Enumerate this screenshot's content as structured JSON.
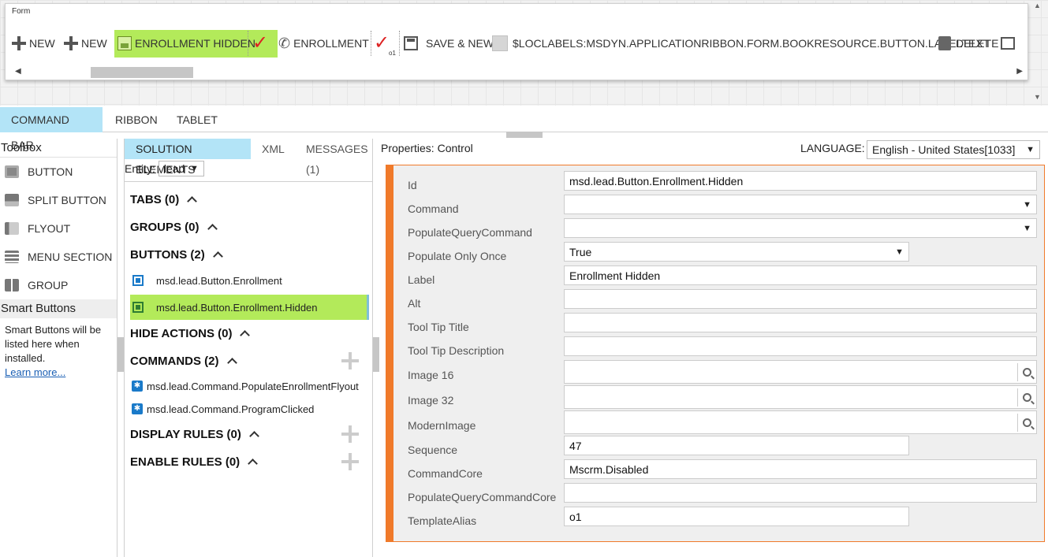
{
  "preview": {
    "form_label": "Form",
    "ribbon": {
      "new1": "NEW",
      "new2": "NEW",
      "enrollment_hidden": "ENROLLMENT HIDDEN",
      "enrollment": "ENROLLMENT",
      "o1": "o1",
      "save_new": "SAVE & NEW",
      "book_resource": "$LOCLABELS:MSDYN.APPLICATIONRIBBON.FORM.BOOKRESOURCE.BUTTON.LABELTEXT",
      "delete": "DELETE"
    }
  },
  "tabs": [
    "COMMAND BAR",
    "RIBBON",
    "TABLET"
  ],
  "toolbox": {
    "title": "Toolbox",
    "items": [
      "BUTTON",
      "SPLIT BUTTON",
      "FLYOUT",
      "MENU SECTION",
      "GROUP"
    ],
    "smart_title": "Smart Buttons",
    "smart_text": "Smart Buttons will be listed here when installed.",
    "learn_more": "Learn more..."
  },
  "solution": {
    "tabs": [
      "SOLUTION ELEMENTS",
      "XML",
      "MESSAGES (1)"
    ],
    "entity_label": "Entity:",
    "entity_value": "lead",
    "sections": {
      "tabs": "TABS (0)",
      "groups": "GROUPS (0)",
      "buttons": "BUTTONS (2)",
      "hide_actions": "HIDE ACTIONS (0)",
      "commands": "COMMANDS (2)",
      "display_rules": "DISPLAY RULES (0)",
      "enable_rules": "ENABLE RULES (0)"
    },
    "buttons": [
      "msd.lead.Button.Enrollment",
      "msd.lead.Button.Enrollment.Hidden"
    ],
    "commands": [
      "msd.lead.Command.PopulateEnrollmentFlyout",
      "msd.lead.Command.ProgramClicked"
    ]
  },
  "properties": {
    "title": "Properties: Control",
    "language_label": "LANGUAGE:",
    "language_value": "English - United States[1033]",
    "fields": {
      "id": {
        "label": "Id",
        "value": "msd.lead.Button.Enrollment.Hidden"
      },
      "command": {
        "label": "Command",
        "value": ""
      },
      "populate_query_command": {
        "label": "PopulateQueryCommand",
        "value": ""
      },
      "populate_only_once": {
        "label": "Populate Only Once",
        "value": "True"
      },
      "label": {
        "label": "Label",
        "value": "Enrollment Hidden"
      },
      "alt": {
        "label": "Alt",
        "value": ""
      },
      "tooltip_title": {
        "label": "Tool Tip Title",
        "value": ""
      },
      "tooltip_description": {
        "label": "Tool Tip Description",
        "value": ""
      },
      "image16": {
        "label": "Image 16",
        "value": ""
      },
      "image32": {
        "label": "Image 32",
        "value": ""
      },
      "modern_image": {
        "label": "ModernImage",
        "value": ""
      },
      "sequence": {
        "label": "Sequence",
        "value": "47"
      },
      "command_core": {
        "label": "CommandCore",
        "value": "Mscrm.Disabled"
      },
      "populate_query_command_core": {
        "label": "PopulateQueryCommandCore",
        "value": ""
      },
      "template_alias": {
        "label": "TemplateAlias",
        "value": "o1"
      }
    }
  }
}
